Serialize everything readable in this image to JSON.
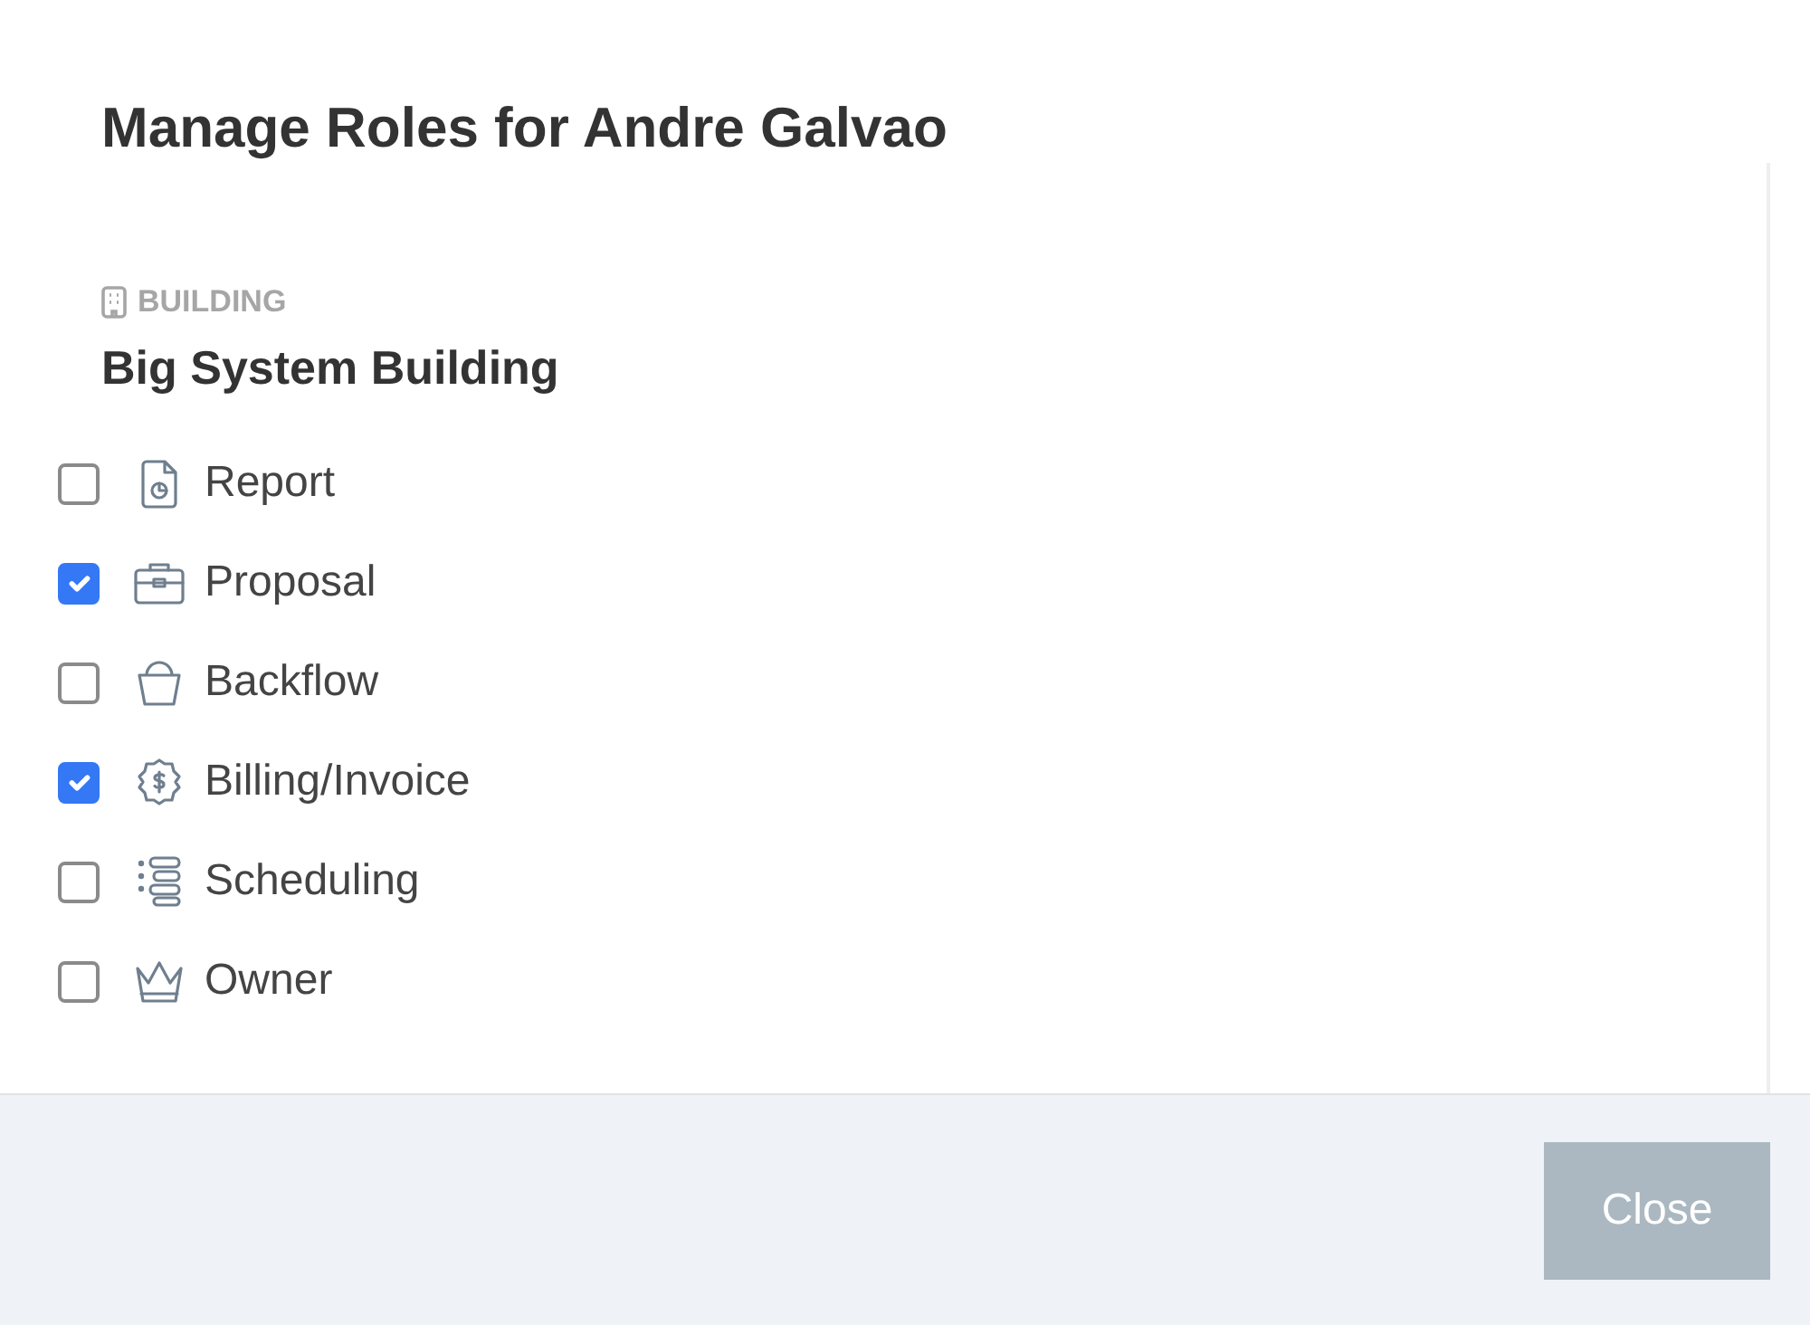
{
  "dialog": {
    "title": "Manage Roles for Andre Galvao"
  },
  "building": {
    "label": "BUILDING",
    "name": "Big System Building"
  },
  "roles": [
    {
      "label": "Report",
      "checked": false
    },
    {
      "label": "Proposal",
      "checked": true
    },
    {
      "label": "Backflow",
      "checked": false
    },
    {
      "label": "Billing/Invoice",
      "checked": true
    },
    {
      "label": "Scheduling",
      "checked": false
    },
    {
      "label": "Owner",
      "checked": false
    }
  ],
  "footer": {
    "close_button": "Close"
  }
}
